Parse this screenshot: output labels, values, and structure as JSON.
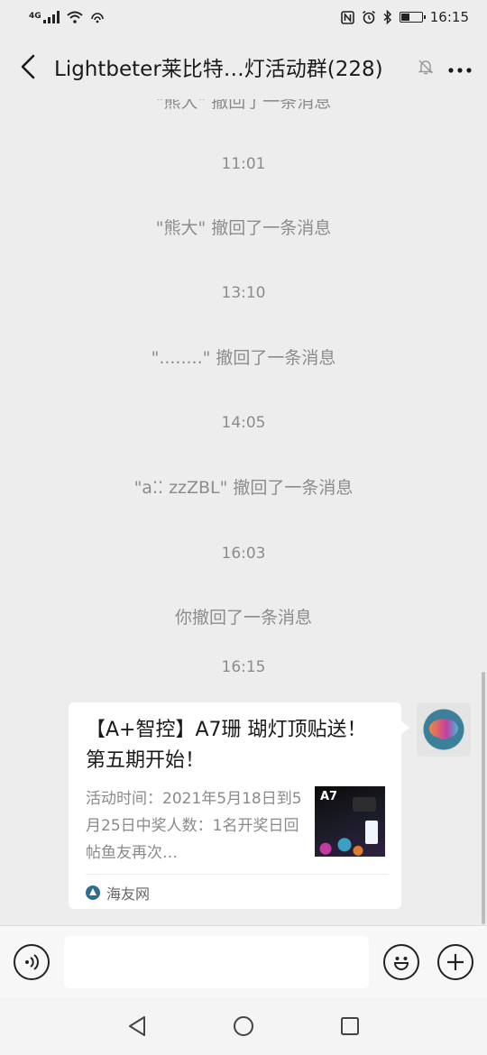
{
  "status_bar": {
    "network": "4G",
    "time": "16:15"
  },
  "header": {
    "title": "Lightbeter莱比特…灯活动群(228)"
  },
  "messages": {
    "partial_top": "\"熊大\" 撤回了一条消息",
    "t1": "11:01",
    "m1": "\"熊大\" 撤回了一条消息",
    "t2": "13:10",
    "m2": "\"........\" 撤回了一条消息",
    "t3": "14:05",
    "m3": "\"a⁚⁚ zzZBL\" 撤回了一条消息",
    "t4": "16:03",
    "m4": "你撤回了一条消息",
    "t5": "16:15"
  },
  "card": {
    "title": "【A+智控】A7珊 瑚灯顶贴送！第五期开始！",
    "description": "活动时间：2021年5月18日到5月25日中奖人数：1名开奖日回帖鱼友再次…",
    "thumbnail_label": "A7",
    "source": "海友网"
  },
  "input": {
    "placeholder": ""
  },
  "colors": {
    "background": "#ededed",
    "card": "#ffffff",
    "muted_text": "#8c8c8c"
  },
  "icons": {
    "back": "back-arrow-icon",
    "mute": "bell-off-icon",
    "more": "more-dots-icon",
    "voice": "voice-icon",
    "emoji": "emoji-icon",
    "plus": "plus-icon",
    "nav_back": "triangle-back-icon",
    "nav_home": "circle-home-icon",
    "nav_recent": "square-recent-icon"
  }
}
